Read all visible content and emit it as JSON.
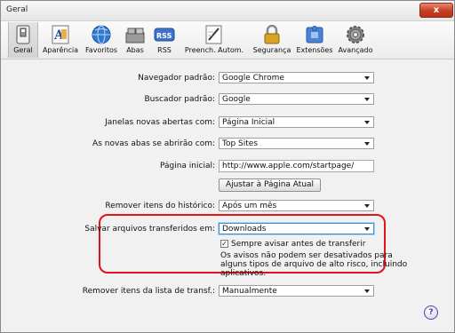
{
  "window": {
    "title": "Geral",
    "close_label": "x"
  },
  "toolbar": {
    "items": [
      {
        "label": "Geral",
        "icon": "switch-icon"
      },
      {
        "label": "Aparência",
        "icon": "font-icon"
      },
      {
        "label": "Favoritos",
        "icon": "globe-icon"
      },
      {
        "label": "Abas",
        "icon": "tabs-icon"
      },
      {
        "label": "RSS",
        "icon": "rss-icon"
      },
      {
        "label": "Preench. Autom.",
        "icon": "pencil-icon"
      },
      {
        "label": "Segurança",
        "icon": "lock-icon"
      },
      {
        "label": "Extensões",
        "icon": "puzzle-icon"
      },
      {
        "label": "Avançado",
        "icon": "gear-icon"
      }
    ],
    "rss_text": "RSS"
  },
  "settings": {
    "default_browser": {
      "label": "Navegador padrão:",
      "value": "Google Chrome"
    },
    "default_search": {
      "label": "Buscador padrão:",
      "value": "Google"
    },
    "new_windows": {
      "label": "Janelas novas abertas com:",
      "value": "Página Inicial"
    },
    "new_tabs": {
      "label": "As novas abas se abrirão com:",
      "value": "Top Sites"
    },
    "homepage": {
      "label": "Página inicial:",
      "value": "http://www.apple.com/startpage/"
    },
    "set_current_page": "Ajustar à Página Atual",
    "history": {
      "label": "Remover itens do histórico:",
      "value": "Após um mês"
    },
    "save_downloads": {
      "label": "Salvar arquivos transferidos em:",
      "value": "Downloads"
    },
    "always_warn": {
      "label": "Sempre avisar antes de transferir",
      "checked": true,
      "check_glyph": "✓"
    },
    "warn_note": [
      "Os avisos não podem ser desativados para",
      "alguns tipos de arquivo de alto risco, incluindo",
      "aplicativos."
    ],
    "remove_downloads": {
      "label": "Remover itens da lista de transf.:",
      "value": "Manualmente"
    }
  },
  "help_label": "?",
  "colors": {
    "highlight": "#e0141c",
    "accent": "#3a8fd9",
    "close": "#c73d22"
  }
}
